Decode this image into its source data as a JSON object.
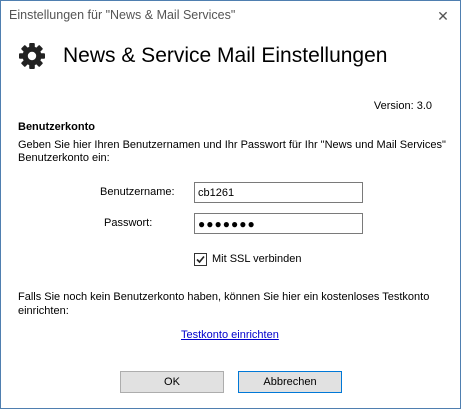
{
  "window": {
    "title": "Einstellungen für \"News & Mail Services\"",
    "close_glyph": "✕"
  },
  "header": {
    "icon": "gear-icon",
    "title": "News & Service Mail Einstellungen"
  },
  "version": "Version: 3.0",
  "account": {
    "heading": "Benutzerkonto",
    "intro": "Geben Sie hier Ihren Benutzernamen und Ihr Passwort für Ihr \"News und Mail Services\" Benutzerkonto ein:",
    "username_label": "Benutzername:",
    "username_value": "cb1261",
    "password_label": "Passwort:",
    "password_value": "●●●●●●●",
    "ssl_label": "Mit SSL verbinden",
    "ssl_checked": true
  },
  "signup": {
    "text": "Falls Sie noch kein Benutzerkonto haben, können Sie hier ein kostenloses Testkonto einrichten:",
    "link": "Testkonto einrichten"
  },
  "buttons": {
    "ok": "OK",
    "cancel": "Abbrechen"
  },
  "colors": {
    "accent_border": "#0078d7",
    "link": "#0000cc"
  }
}
